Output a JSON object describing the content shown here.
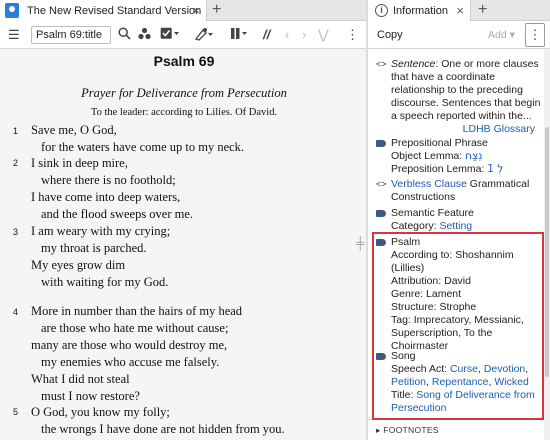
{
  "left_tab": {
    "title": "The New Revised Standard Version",
    "close": "×",
    "add": "+"
  },
  "toolbar": {
    "reference": "Psalm 69:title"
  },
  "psalm": {
    "title": "Psalm 69",
    "heading": "Prayer for Deliverance from Persecution",
    "superscription": "To the leader: according to Lilies. Of David.",
    "verse_numbers": [
      "1",
      "2",
      "3",
      "4",
      "5"
    ],
    "lines": [
      "Save me, O God,",
      "for the waters have come up to my neck.",
      "I sink in deep mire,",
      "where there is no foothold;",
      "I have come into deep waters,",
      "and the flood sweeps over me.",
      "I am weary with my crying;",
      "my throat is parched.",
      "My eyes grow dim",
      "with waiting for my God.",
      "More in number than the hairs of my head",
      "are those who hate me without cause;",
      "many are those who would destroy me,",
      "my enemies who accuse me falsely.",
      "What I did not steal",
      "must I now restore?",
      "O God, you know my folly;",
      "the wrongs I have done are not hidden from you."
    ]
  },
  "right_tab": {
    "title": "Information",
    "close": "×",
    "add": "+"
  },
  "right_toolbar": {
    "copy": "Copy",
    "add": "Add ▾",
    "more": "⋮"
  },
  "info": {
    "sentence": {
      "label": "Sentence",
      "text": ": One or more clauses that have a coordinate relationship to the preceding discourse. Sentences that begin a speech reported within the...",
      "source": "LDHB Glossary"
    },
    "prep_phrase": {
      "title": "Prepositional Phrase",
      "object_label": "Object Lemma: ",
      "object_value": "נֵצַח",
      "prep_label": "Preposition Lemma: ",
      "prep_value": "לְ 1"
    },
    "verbless": {
      "link": "Verbless Clause",
      "rest": " Grammatical Constructions"
    },
    "semantic": {
      "title": "Semantic Feature",
      "cat_label": "Category: ",
      "cat_value": "Setting"
    },
    "psalm": {
      "title": "Psalm",
      "according_label": "According to: ",
      "according_value": "Shoshannim (Lillies)",
      "attribution_label": "Attribution: ",
      "attribution_value": "David",
      "genre_label": "Genre: ",
      "genre_value": "Lament",
      "structure_label": "Structure: ",
      "structure_value": "Strophe",
      "tag_label": "Tag: ",
      "tag_value": "Imprecatory, Messianic, Superscription, To the Choirmaster"
    },
    "song": {
      "title": "Song",
      "speech_label": "Speech Act: ",
      "speech_values": [
        "Curse",
        "Devotion",
        "Petition",
        "Repentance",
        "Wicked"
      ],
      "title_label": "Title: ",
      "title_value": "Song of Deliverance from Persecution"
    },
    "footnotes": "FOOTNOTES"
  }
}
